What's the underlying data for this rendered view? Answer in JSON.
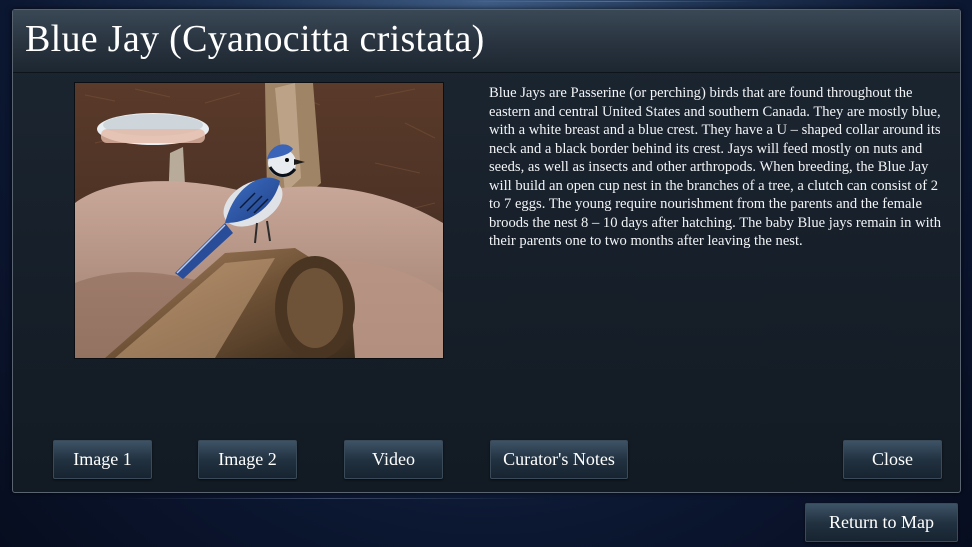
{
  "panel": {
    "title": "Blue Jay (Cyanocitta cristata)",
    "description": "Blue Jays are Passerine (or perching) birds that are found throughout the eastern and central United States and southern Canada. They are mostly blue, with a white breast and a blue crest. They have a U – shaped collar around its neck and a black border behind its crest. Jays will feed mostly on nuts and seeds, as well as insects and other arthropods. When breeding, the Blue Jay will build an open cup nest in the branches of a tree, a clutch can consist of 2 to 7 eggs. The young require nourishment from the parents and the female broods the nest 8 – 10 days after hatching. The baby Blue jays remain in with their parents one to two months after leaving the nest.",
    "photo_subject": "blue-jay-perched-on-log"
  },
  "buttons": {
    "image1": "Image 1",
    "image2": "Image 2",
    "video": "Video",
    "curators_notes": "Curator's Notes",
    "close": "Close"
  },
  "footer": {
    "return_to_map": "Return to Map"
  },
  "colors": {
    "background_dark": "#0b1630",
    "panel": "#121a23",
    "button_top": "#3d5366",
    "button_bottom": "#172330",
    "text": "#ffffff"
  }
}
